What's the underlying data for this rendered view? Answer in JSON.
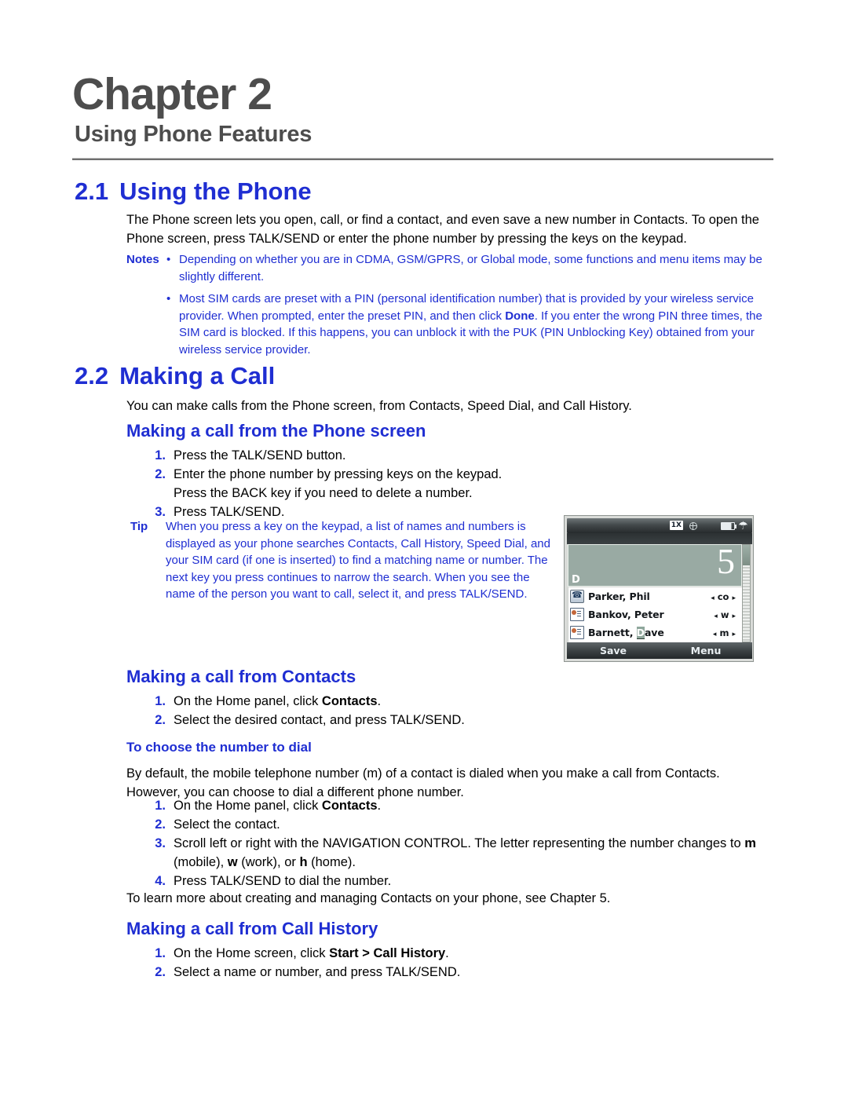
{
  "chapter": {
    "title": "Chapter 2",
    "subtitle": "Using Phone Features"
  },
  "sections": {
    "using_phone": {
      "number": "2.1",
      "title": "Using the Phone",
      "intro": "The Phone screen lets you open, call, or find a contact, and even save a new number in Contacts. To open the Phone screen, press TALK/SEND or enter the phone number by pressing the keys on the keypad.",
      "notes_label": "Notes",
      "bullet": "•",
      "note1": "Depending on whether you are in CDMA, GSM/GPRS, or Global mode, some functions and menu items may be slightly different.",
      "note2_a": "Most SIM cards are preset with a PIN (personal identification number) that is provided by your wireless service provider. When prompted, enter the preset PIN, and then click ",
      "note2_bold": "Done",
      "note2_b": ". If you enter the wrong PIN three times, the SIM card is blocked. If this happens, you can unblock it with the PUK (PIN Unblocking Key) obtained from your wireless service provider."
    },
    "making_call": {
      "number": "2.2",
      "title": "Making a Call",
      "intro": "You can make calls from the Phone screen, from Contacts, Speed Dial, and Call History.",
      "from_phone_screen": {
        "heading": "Making a call from the Phone screen",
        "steps": [
          {
            "mark": "1.",
            "text": "Press the TALK/SEND button."
          },
          {
            "mark": "2.",
            "text": "Enter the phone number by pressing keys on the keypad."
          },
          {
            "mark": "",
            "text": "Press the BACK key if you need to delete a number."
          },
          {
            "mark": "3.",
            "text": "Press TALK/SEND."
          }
        ],
        "tip_label": "Tip",
        "tip_text": "When you press a key on the keypad, a list of names and numbers is displayed as your phone searches Contacts, Call History, Speed Dial, and your SIM card (if one is inserted) to find a matching name or number. The next key you press continues to narrow the search. When you see the name of the person you want to call, select it, and press TALK/SEND."
      },
      "from_contacts": {
        "heading": "Making a call from Contacts",
        "step1_a": "On the Home panel, click ",
        "step1_bold": "Contacts",
        "step1_b": ".",
        "step1_mark": "1.",
        "step2_mark": "2.",
        "step2": "Select the desired contact, and press TALK/SEND.",
        "choose_number": {
          "heading": "To choose the number to dial",
          "intro": "By default, the mobile telephone number (m) of a contact is dialed when you make a call from Contacts. However, you can choose to dial a different phone number.",
          "s1_mark": "1.",
          "s1_a": "On the Home panel, click ",
          "s1_bold": "Contacts",
          "s1_b": ".",
          "s2_mark": "2.",
          "s2": "Select the contact.",
          "s3_mark": "3.",
          "s3_a": "Scroll left or right with the NAVIGATION CONTROL. The letter representing the number changes to ",
          "s3_b1": "m",
          "s3_b": " (mobile), ",
          "s3_b2": "w",
          "s3_c": " (work), or ",
          "s3_b3": "h",
          "s3_d": " (home).",
          "s4_mark": "4.",
          "s4": "Press TALK/SEND to dial the number.",
          "closing": "To learn more about creating and managing Contacts on your phone, see Chapter 5."
        }
      },
      "from_call_history": {
        "heading": "Making a call from Call History",
        "s1_mark": "1.",
        "s1_a": "On the Home screen, click ",
        "s1_bold": "Start > Call History",
        "s1_b": ".",
        "s2_mark": "2.",
        "s2": "Select a name or number, and press TALK/SEND."
      }
    }
  },
  "phone_screenshot": {
    "status_bar": {
      "network": "1X",
      "globe_icon": "globe-icon",
      "battery_icon": "battery-icon",
      "signal_icon": "signal-icon"
    },
    "input": {
      "digits": "5",
      "letter": "D"
    },
    "contacts": [
      {
        "icon": "missed-call-icon",
        "name_prefix": "Parker, Phil",
        "name_highlight": "",
        "name_suffix": "",
        "type": "co"
      },
      {
        "icon": "contact-card-icon",
        "name_prefix": "Bankov, Peter",
        "name_highlight": "",
        "name_suffix": "",
        "type": "w"
      },
      {
        "icon": "contact-card-icon",
        "name_prefix": "Barnett, ",
        "name_highlight": "D",
        "name_suffix": "ave",
        "type": "m"
      }
    ],
    "soft_keys": {
      "left": "Save",
      "right": "Menu"
    },
    "arrow_left": "◂",
    "arrow_right": "▸"
  },
  "colors": {
    "heading_blue": "#1f2ed2",
    "chapter_gray": "#4d4d4d",
    "body_black": "#000000"
  }
}
